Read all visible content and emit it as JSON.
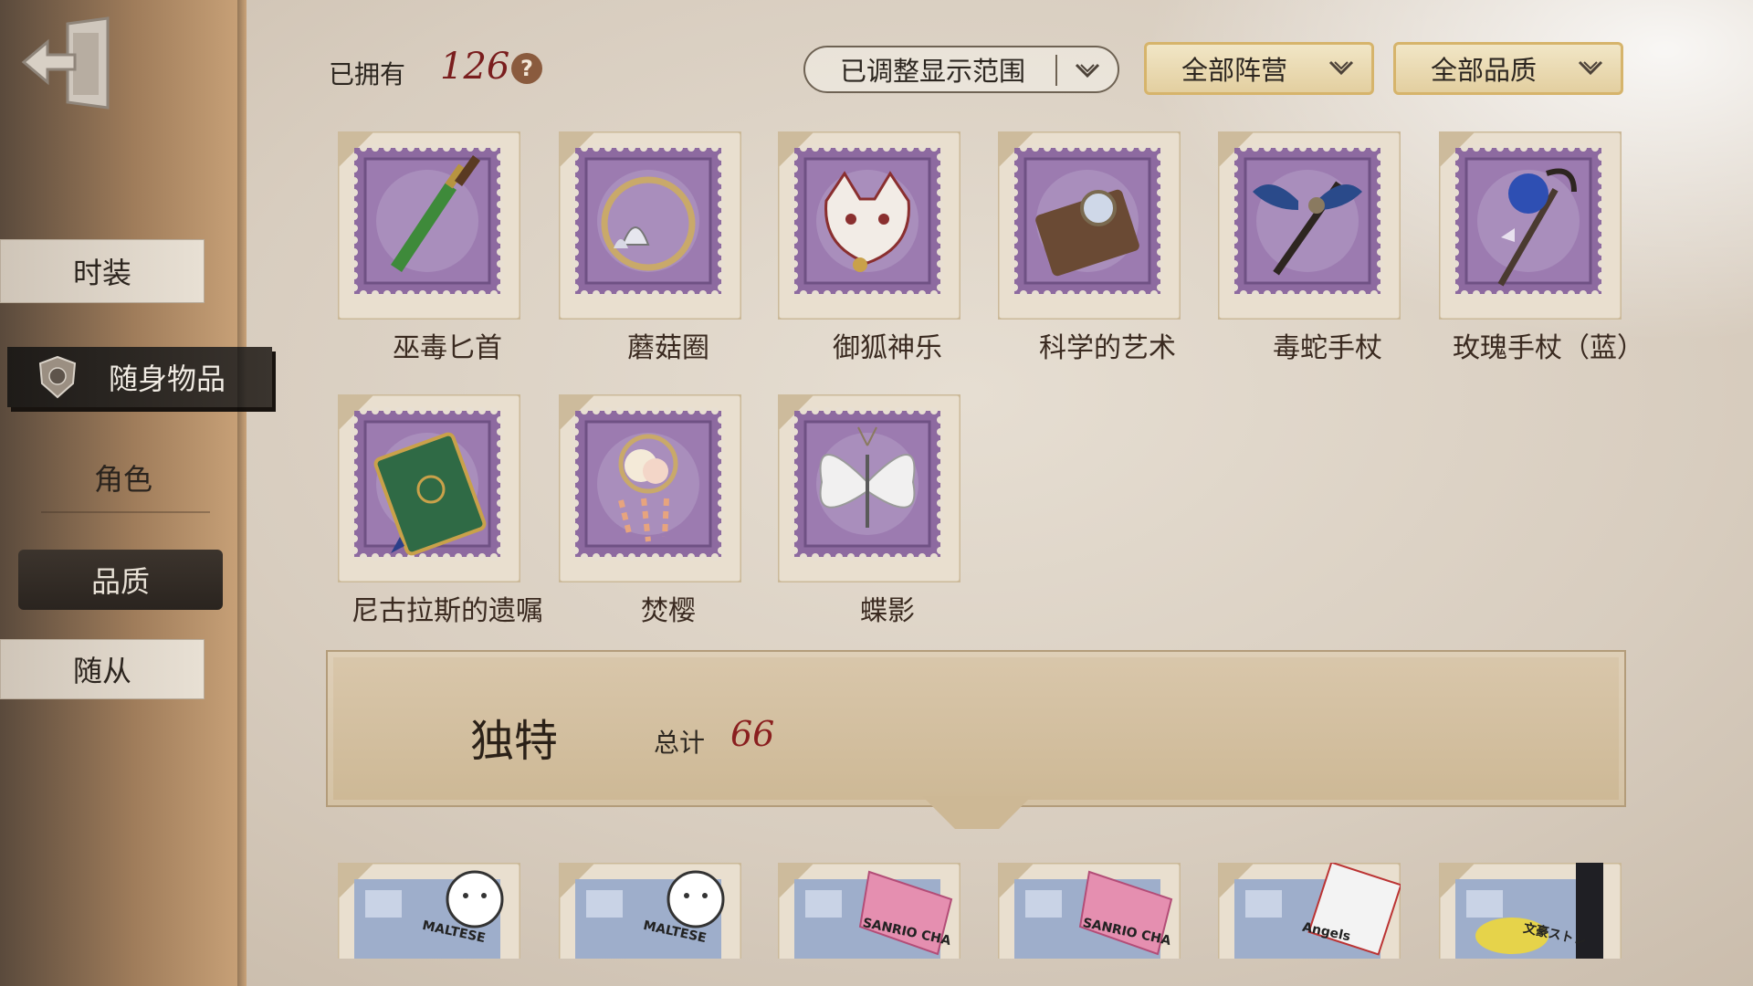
{
  "sidebar": {
    "tabs": [
      {
        "label": "时装"
      },
      {
        "label": "随身物品"
      },
      {
        "label": "角色"
      },
      {
        "label": "品质"
      },
      {
        "label": "随从"
      }
    ]
  },
  "header": {
    "owned_label": "已拥有",
    "owned_count": "126",
    "help": "?",
    "range_dropdown": "已调整显示范围",
    "camp_dropdown": "全部阵营",
    "quality_dropdown": "全部品质"
  },
  "items": [
    {
      "name": "巫毒匕首",
      "icon": "voodoo-dagger"
    },
    {
      "name": "蘑菇圈",
      "icon": "mushroom-ring"
    },
    {
      "name": "御狐神乐",
      "icon": "fox-mask"
    },
    {
      "name": "科学的艺术",
      "icon": "science-art"
    },
    {
      "name": "毒蛇手杖",
      "icon": "viper-cane"
    },
    {
      "name": "玫瑰手杖（蓝）",
      "icon": "blue-rose-cane"
    },
    {
      "name": "尼古拉斯的遗嘱",
      "icon": "green-book"
    },
    {
      "name": "焚樱",
      "icon": "sakura-charm"
    },
    {
      "name": "蝶影",
      "icon": "butterfly-shadow"
    }
  ],
  "unique_section": {
    "title": "独特",
    "total_label": "总计",
    "total": "66"
  },
  "bottom_cards": [
    {
      "label": "MALTESE",
      "icon": "bear-card"
    },
    {
      "label": "MALTESE",
      "icon": "bear-card"
    },
    {
      "label": "SANRIO CHA",
      "icon": "sanrio-card"
    },
    {
      "label": "SANRIO CHA",
      "icon": "sanrio-card"
    },
    {
      "label": "Angels",
      "icon": "angels-card"
    },
    {
      "label": "文豪ストレ",
      "icon": "bungo-card"
    }
  ],
  "colors": {
    "count_red": "#7a1e1e",
    "stamp_purple": "#8d6aa0",
    "gold_border": "#d6b46b"
  }
}
